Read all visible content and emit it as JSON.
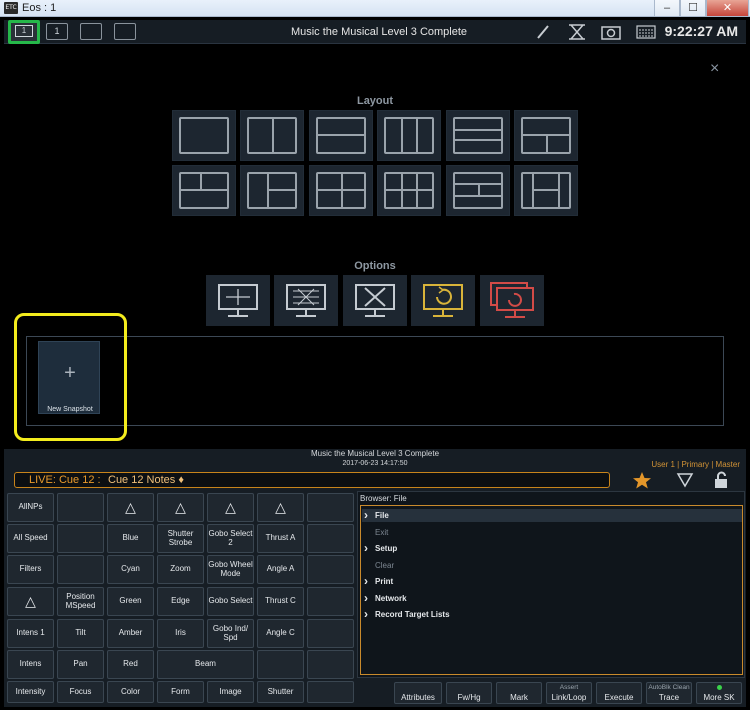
{
  "window": {
    "title": "Eos : 1",
    "logo": "ETC",
    "min": "–",
    "max": "☐",
    "close": "✕"
  },
  "topbar": {
    "tabs": [
      "1",
      "1"
    ],
    "show_title": "Music the Musical Level 3 Complete",
    "time": "9:22:27 AM"
  },
  "layout": {
    "label": "Layout"
  },
  "options": {
    "label": "Options"
  },
  "snapshot": {
    "new_label": "New Snapshot",
    "plus": "+"
  },
  "close_icon": "×",
  "cue_info": {
    "title": "Music the Musical Level 3 Complete",
    "date": "2017-06-23 14:17:50"
  },
  "user": {
    "label": "User 1  |  Primary  |  Master"
  },
  "live": {
    "text": "LIVE: Cue  12 :  ",
    "note": "Cue 12 Notes ♦"
  },
  "param_buttons": [
    [
      "AllNPs",
      "",
      "△",
      "△",
      "△",
      "△",
      ""
    ],
    [
      "All Speed",
      "",
      "Blue",
      "Shutter Strobe",
      "Gobo Select 2",
      "Thrust A",
      ""
    ],
    [
      "Filters",
      "",
      "Cyan",
      "Zoom",
      "Gobo Wheel Mode",
      "Angle A",
      ""
    ],
    [
      "△",
      "Position MSpeed",
      "Green",
      "Edge",
      "Gobo Select",
      "Thrust C",
      ""
    ],
    [
      "Intens 1",
      "Tilt",
      "Amber",
      "Iris",
      "Gobo Ind/ Spd",
      "Angle C",
      ""
    ],
    [
      "Intens",
      "Pan",
      "Red",
      "Beam",
      "",
      "",
      ""
    ],
    [
      "Intensity",
      "Focus",
      "Color",
      "Form",
      "Image",
      "Shutter",
      ""
    ]
  ],
  "browser": {
    "title": "Browser: File",
    "items": [
      {
        "label": "File",
        "arrow": true,
        "dim": false
      },
      {
        "label": "Exit",
        "arrow": false,
        "dim": true
      },
      {
        "label": "Setup",
        "arrow": true,
        "dim": false
      },
      {
        "label": "Clear",
        "arrow": false,
        "dim": true
      },
      {
        "label": "Print",
        "arrow": true,
        "dim": false
      },
      {
        "label": "Network",
        "arrow": true,
        "dim": false
      },
      {
        "label": "Record Target Lists",
        "arrow": true,
        "dim": false
      }
    ]
  },
  "softkeys": [
    {
      "top": "",
      "label": "Attributes"
    },
    {
      "top": "",
      "label": "Fw/Hg"
    },
    {
      "top": "",
      "label": "Mark"
    },
    {
      "top": "Assert",
      "label": "Link/Loop"
    },
    {
      "top": "",
      "label": "Execute"
    },
    {
      "top": "AutoBlk Clean",
      "label": "Trace"
    },
    {
      "top": "",
      "label": "More SK"
    }
  ],
  "colors": {
    "accent": "#e89a2c",
    "highlight": "#f3ec1d",
    "active_tab": "#26b84a"
  }
}
